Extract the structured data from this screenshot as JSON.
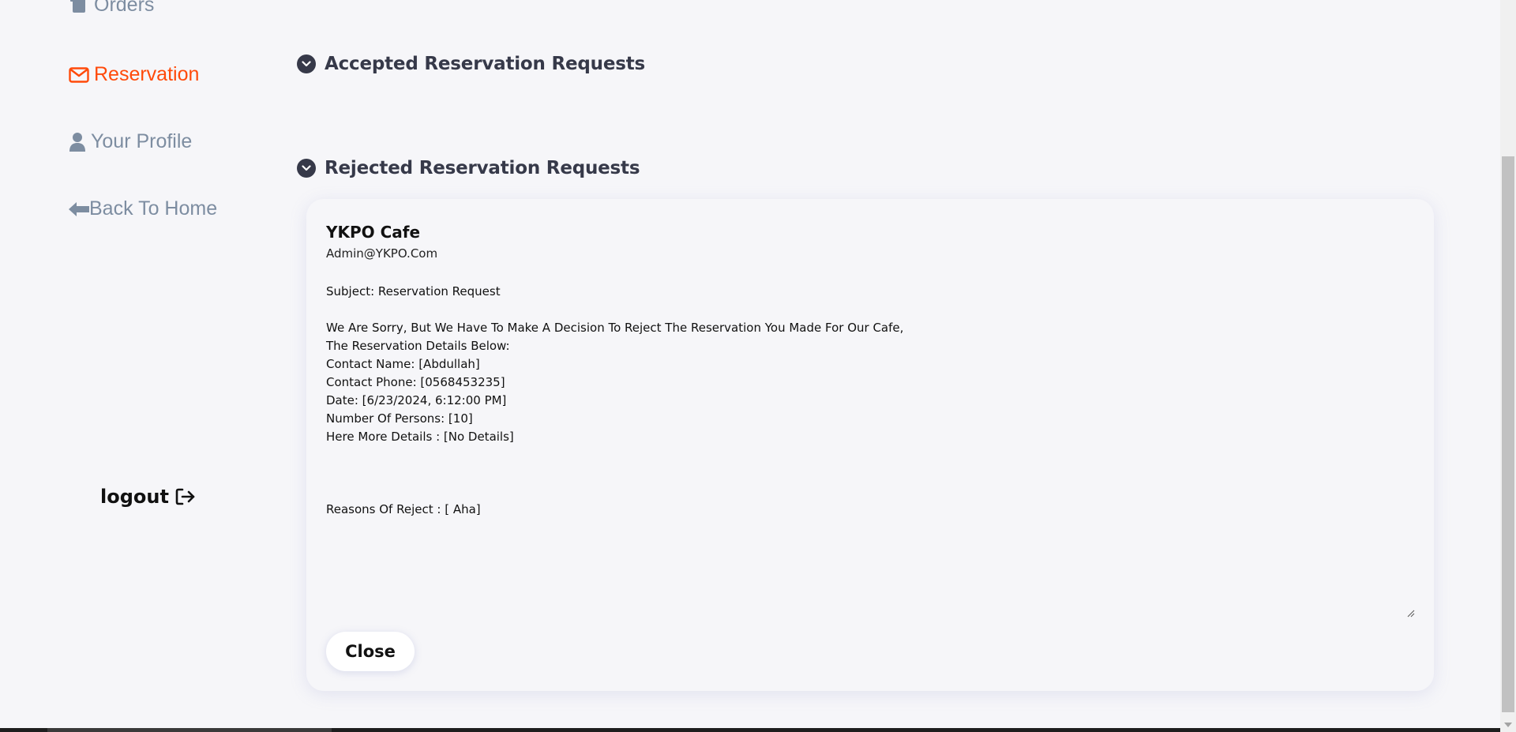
{
  "sidebar": {
    "items": [
      {
        "label": "Orders",
        "icon": "orders-icon",
        "active": false
      },
      {
        "label": "Reservation",
        "icon": "envelope-icon",
        "active": true
      },
      {
        "label": "Your Profile",
        "icon": "user-icon",
        "active": false
      },
      {
        "label": "Back To Home",
        "icon": "arrow-left-icon",
        "active": false
      }
    ],
    "logout_label": "logout",
    "logout_icon": "logout-icon"
  },
  "sections": {
    "accepted_title": "Accepted Reservation Requests",
    "rejected_title": "Rejected Reservation Requests"
  },
  "rejected_card": {
    "cafe_name": "YKPO Cafe",
    "email": "Admin@YKPO.Com",
    "message_lines": [
      "Subject: Reservation Request",
      "",
      "We Are Sorry, But We Have To Make A Decision To Reject The Reservation You Made For Our Cafe,",
      "The Reservation Details Below:",
      "Contact Name: [Abdullah]",
      "Contact Phone: [0568453235]",
      "Date: [6/23/2024, 6:12:00 PM]",
      "Number Of Persons: [10]",
      "Here More Details : [No Details]",
      "",
      "",
      "",
      "Reasons Of Reject : [ Aha]"
    ],
    "close_label": "Close"
  },
  "colors": {
    "accent": "#ff4a0a",
    "muted": "#7d8da1",
    "dark": "#363949",
    "background": "#f6f6f9"
  }
}
